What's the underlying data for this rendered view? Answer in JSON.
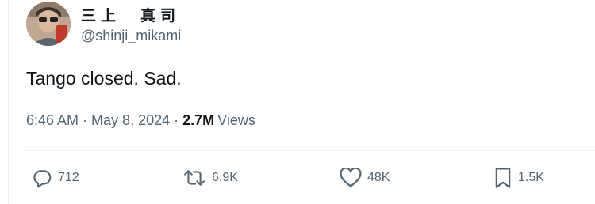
{
  "author": {
    "display_name": "三上　真司",
    "handle": "@shinji_mikami"
  },
  "tweet": {
    "text": "Tango closed. Sad.",
    "time": "6:46 AM",
    "separator": "·",
    "date": "May 8, 2024",
    "views_count": "2.7M",
    "views_label": "Views"
  },
  "actions": {
    "replies": "712",
    "reposts": "6.9K",
    "likes": "48K",
    "bookmarks": "1.5K"
  },
  "icons": {
    "reply": "reply-icon",
    "repost": "repost-icon",
    "like": "heart-icon",
    "bookmark": "bookmark-icon"
  },
  "colors": {
    "primary_text": "#0f1419",
    "secondary_text": "#536471",
    "border": "#eff3f4"
  }
}
